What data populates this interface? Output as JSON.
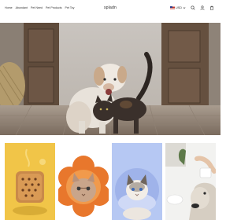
{
  "header": {
    "nav": [
      {
        "label": "Home"
      },
      {
        "label": "Abundant"
      },
      {
        "label": "Pet Need"
      },
      {
        "label": "Pet Products"
      },
      {
        "label": "Pet Toy"
      }
    ],
    "brand": "spladn",
    "currency": "USD",
    "icons": [
      "search-icon",
      "user-icon",
      "cart-icon"
    ]
  },
  "hero": {
    "image": "dog-and-cat-in-doorway"
  },
  "tiles": [
    {
      "image": "cookie-cat-bed"
    },
    {
      "image": "cat-in-flower-cushion"
    },
    {
      "image": "ragdoll-cat-cone-collar"
    },
    {
      "image": "dog-with-cup"
    }
  ],
  "colors": {
    "tile1_bg": "#f1c548",
    "tile2_bg": "#ffffff",
    "tile3_bg": "#b6c8f3",
    "tile4_bg": "#f2f2f0"
  }
}
